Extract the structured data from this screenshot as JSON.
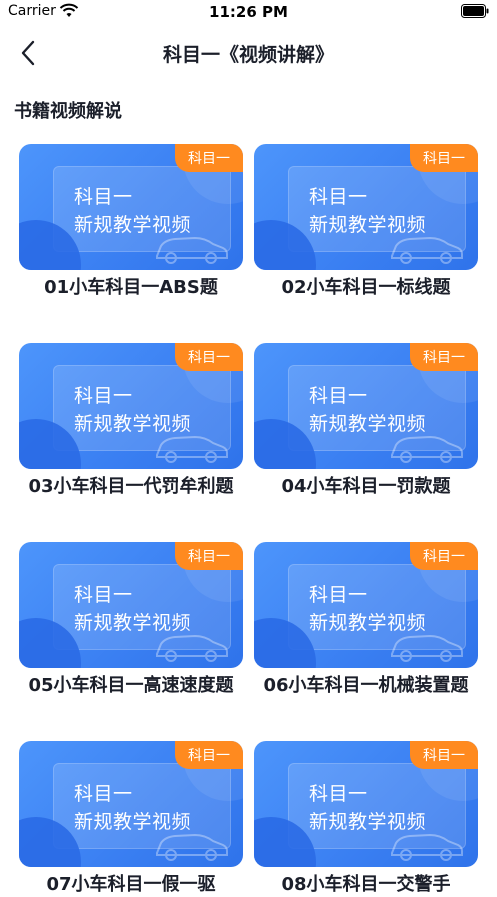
{
  "status": {
    "carrier": "Carrier",
    "time": "11:26 PM"
  },
  "nav": {
    "title": "科目一《视频讲解》"
  },
  "section": {
    "title": "书籍视频解说"
  },
  "thumbnail": {
    "line1": "科目一",
    "line2": "新规教学视频",
    "badge": "科目一"
  },
  "videos": [
    {
      "title": "01小车科目一ABS题"
    },
    {
      "title": "02小车科目一标线题"
    },
    {
      "title": "03小车科目一代罚牟利题"
    },
    {
      "title": "04小车科目一罚款题"
    },
    {
      "title": "05小车科目一高速速度题"
    },
    {
      "title": "06小车科目一机械装置题"
    },
    {
      "title": "07小车科目一假一驱"
    },
    {
      "title": "08小车科目一交警手"
    }
  ],
  "colors": {
    "accent": "#3a7ff2",
    "badge": "#ff8a1f"
  }
}
